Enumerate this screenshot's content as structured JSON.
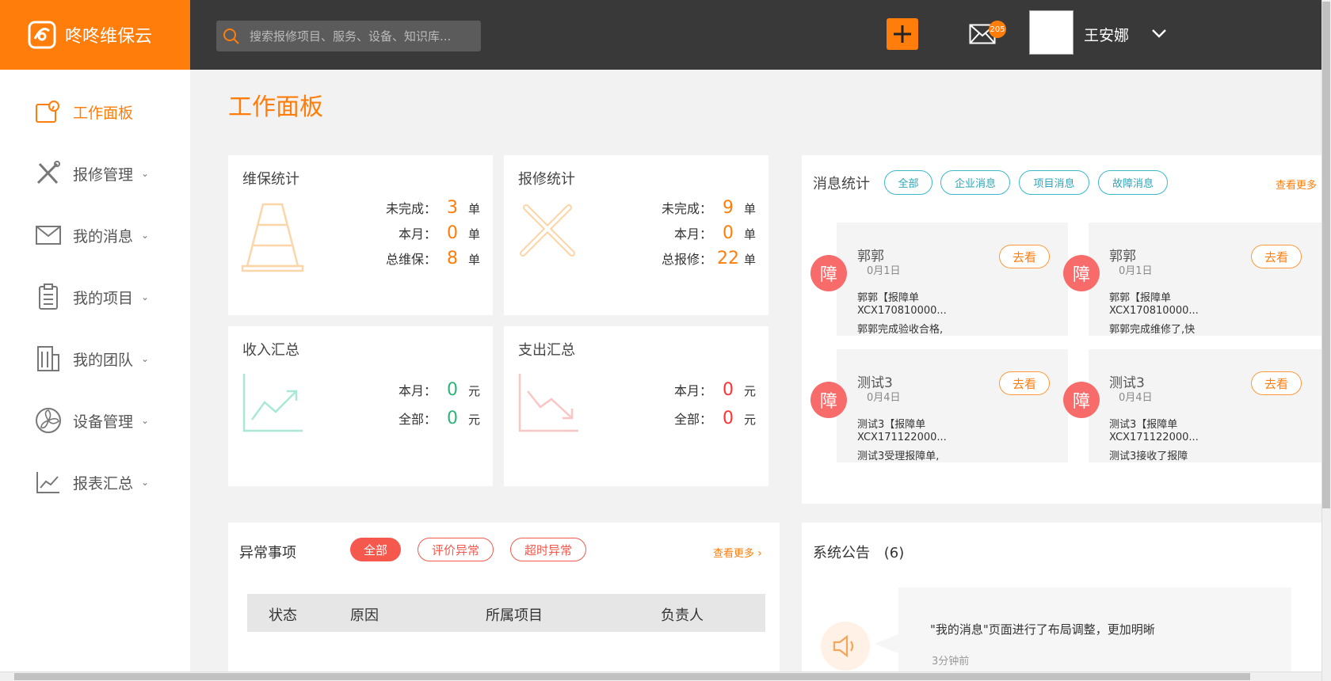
{
  "brand": {
    "name": "咚咚维保云",
    "color": "#ff7d0a"
  },
  "header": {
    "search_placeholder": "搜索报修项目、服务、设备、知识库...",
    "mail_count": "205",
    "username": "王安娜"
  },
  "sidebar": {
    "items": [
      {
        "label": "工作面板",
        "icon": "dashboard-icon",
        "active": true
      },
      {
        "label": "报修管理",
        "icon": "tools-icon"
      },
      {
        "label": "我的消息",
        "icon": "mail-icon"
      },
      {
        "label": "我的项目",
        "icon": "clipboard-icon"
      },
      {
        "label": "我的团队",
        "icon": "building-icon"
      },
      {
        "label": "设备管理",
        "icon": "fan-icon"
      },
      {
        "label": "报表汇总",
        "icon": "chart-icon"
      }
    ],
    "chevron": "⌄"
  },
  "page_title": "工作面板",
  "maintenance": {
    "title": "维保统计",
    "rows": [
      {
        "label": "未完成：",
        "value": "3",
        "unit": "单"
      },
      {
        "label": "本月：",
        "value": "0",
        "unit": "单"
      },
      {
        "label": "总维保：",
        "value": "8",
        "unit": "单"
      }
    ]
  },
  "repair": {
    "title": "报修统计",
    "rows": [
      {
        "label": "未完成：",
        "value": "9",
        "unit": "单"
      },
      {
        "label": "本月：",
        "value": "0",
        "unit": "单"
      },
      {
        "label": "总报修：",
        "value": "22",
        "unit": "单"
      }
    ]
  },
  "income": {
    "title": "收入汇总",
    "rows": [
      {
        "label": "本月：",
        "value": "0",
        "unit": "元"
      },
      {
        "label": "全部：",
        "value": "0",
        "unit": "元"
      }
    ]
  },
  "expense": {
    "title": "支出汇总",
    "rows": [
      {
        "label": "本月：",
        "value": "0",
        "unit": "元"
      },
      {
        "label": "全部：",
        "value": "0",
        "unit": "元"
      }
    ]
  },
  "messages": {
    "title": "消息统计",
    "tabs": [
      "全部",
      "企业消息",
      "项目消息",
      "故障消息"
    ],
    "see_more": "查看更多",
    "cards": [
      {
        "badge": "障",
        "name": "郭郭",
        "date": "0月1日",
        "action": "去看",
        "lines": [
          "郭郭【报障单",
          "XCX170810000...",
          "郭郭完成验收合格,"
        ]
      },
      {
        "badge": "障",
        "name": "郭郭",
        "date": "0月1日",
        "action": "去看",
        "lines": [
          "郭郭【报障单",
          "XCX170810000...",
          "郭郭完成维修了,快"
        ]
      },
      {
        "badge": "障",
        "name": "测试3",
        "date": "0月4日",
        "action": "去看",
        "lines": [
          "测试3【报障单",
          "XCX171122000...",
          "测试3受理报障单,"
        ]
      },
      {
        "badge": "障",
        "name": "测试3",
        "date": "0月4日",
        "action": "去看",
        "lines": [
          "测试3【报障单",
          "XCX171122000...",
          "测试3接收了报障"
        ]
      }
    ]
  },
  "abnormal": {
    "title": "异常事项",
    "tabs": [
      "全部",
      "评价异常",
      "超时异常"
    ],
    "see_more": "查看更多",
    "columns": [
      "状态",
      "原因",
      "所属项目",
      "负责人"
    ]
  },
  "announcement": {
    "title": "系统公告",
    "count": "(6)",
    "text": "\"我的消息\"页面进行了布局调整，更加明晰",
    "time": "3分钟前"
  }
}
